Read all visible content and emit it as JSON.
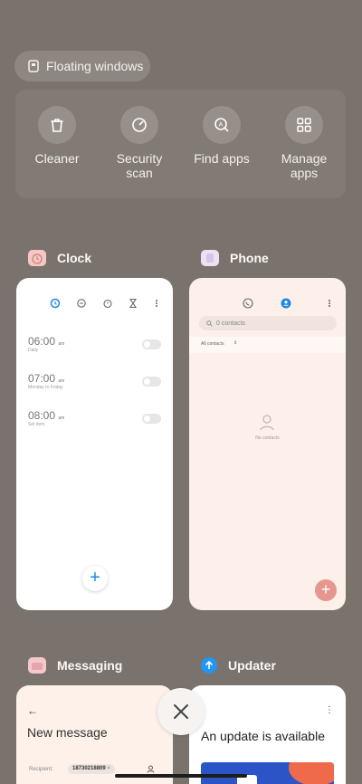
{
  "floating_windows": {
    "label": "Floating windows",
    "icon": "floating-window-icon"
  },
  "quick_actions": [
    {
      "label": "Cleaner",
      "icon": "trash-icon"
    },
    {
      "label": "Security scan",
      "line1": "Security",
      "line2": "scan",
      "icon": "shield-gauge-icon"
    },
    {
      "label": "Find apps",
      "icon": "app-search-icon"
    },
    {
      "label": "Manage apps",
      "line1": "Manage",
      "line2": "apps",
      "icon": "grid-icon"
    }
  ],
  "apps": {
    "clock": {
      "name": "Clock",
      "alarms": [
        {
          "time": "06:00",
          "ampm": "am",
          "sub": "Daily"
        },
        {
          "time": "07:00",
          "ampm": "am",
          "sub": "Monday to Friday"
        },
        {
          "time": "08:00",
          "ampm": "am",
          "sub": "Set item"
        }
      ],
      "add": "+"
    },
    "phone": {
      "name": "Phone",
      "search_placeholder": "0 contacts",
      "filter": "All contacts",
      "empty": "No contacts",
      "add": "+"
    },
    "messaging": {
      "name": "Messaging",
      "back": "←",
      "title": "New message",
      "recipient_label": "Recipient:",
      "recipient_value": "18730218809"
    },
    "updater": {
      "name": "Updater",
      "menu": "⋮",
      "title": "An update is available"
    }
  },
  "close": "✕",
  "colors": {
    "background": "#7a736d",
    "accent_blue": "#1e88e5",
    "fab_red": "#e4968f"
  }
}
